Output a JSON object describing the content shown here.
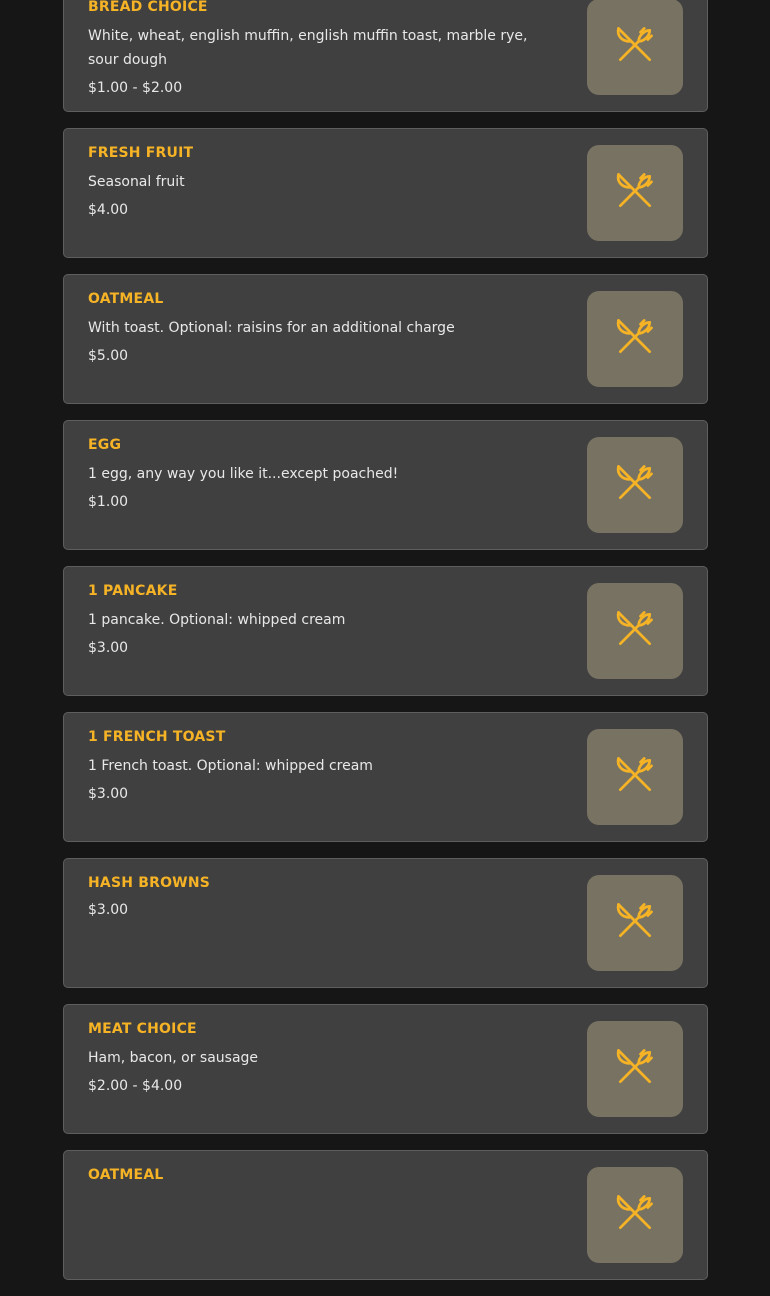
{
  "menu": {
    "items": [
      {
        "name": "BREAD CHOICE",
        "description": "White, wheat, english muffin, english muffin toast, marble rye, sour dough",
        "price": "$1.00 - $2.00"
      },
      {
        "name": "FRESH FRUIT",
        "description": "Seasonal fruit",
        "price": "$4.00"
      },
      {
        "name": "OATMEAL",
        "description": "With toast. Optional: raisins for an additional charge",
        "price": "$5.00"
      },
      {
        "name": "EGG",
        "description": "1 egg, any way you like it...except poached!",
        "price": "$1.00"
      },
      {
        "name": "1 PANCAKE",
        "description": "1 pancake. Optional: whipped cream",
        "price": "$3.00"
      },
      {
        "name": "1 FRENCH TOAST",
        "description": "1 French toast. Optional: whipped cream",
        "price": "$3.00"
      },
      {
        "name": "HASH BROWNS",
        "description": "",
        "price": "$3.00"
      },
      {
        "name": "MEAT CHOICE",
        "description": "Ham, bacon, or sausage",
        "price": "$2.00 - $4.00"
      },
      {
        "name": "OATMEAL",
        "description": "",
        "price": ""
      }
    ],
    "thumbnail_icon": "fork-knife-icon",
    "colors": {
      "background": "#161616",
      "card": "#404040",
      "accent": "#f5b325",
      "thumbnail": "#787262"
    }
  }
}
